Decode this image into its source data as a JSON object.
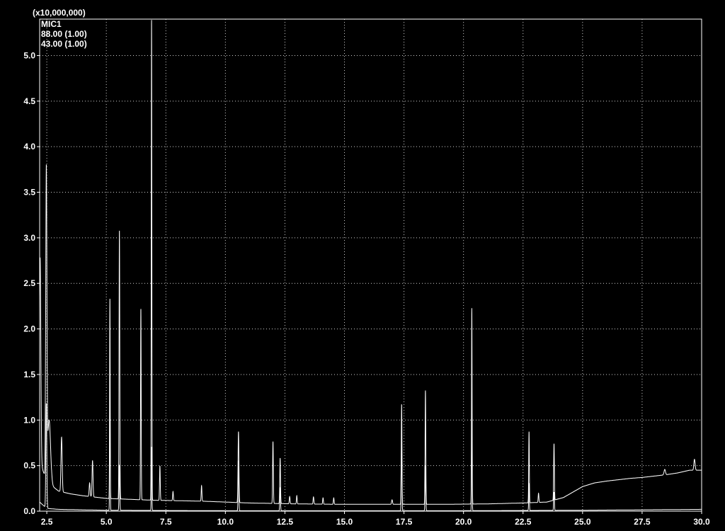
{
  "chart_data": {
    "type": "line",
    "scale_label": "(x10,000,000)",
    "legend": [
      "MIC1",
      "88.00 (1.00)",
      "43.00 (1.00)"
    ],
    "xlabel": "",
    "ylabel": "",
    "xlim": [
      2.2,
      30.0
    ],
    "ylim": [
      0,
      5.4
    ],
    "x_ticks": [
      "2.5",
      "5.0",
      "7.5",
      "10.0",
      "12.5",
      "15.0",
      "17.5",
      "20.0",
      "22.5",
      "25.0",
      "27.5",
      "30.0"
    ],
    "y_ticks": [
      "0.0",
      "0.5",
      "1.0",
      "1.5",
      "2.0",
      "2.5",
      "3.0",
      "3.5",
      "4.0",
      "4.5",
      "5.0"
    ],
    "grid": true,
    "colors": {
      "background": "#000000",
      "trace": "#ffffff",
      "grid": "#ffffff"
    },
    "series": [
      {
        "baseline": [
          [
            2.2,
            0.55
          ],
          [
            2.4,
            0.4
          ],
          [
            2.6,
            0.3
          ],
          [
            3.0,
            0.22
          ],
          [
            3.5,
            0.19
          ],
          [
            4.0,
            0.17
          ],
          [
            5.0,
            0.14
          ],
          [
            6.0,
            0.13
          ],
          [
            7.0,
            0.12
          ],
          [
            8.0,
            0.115
          ],
          [
            9.0,
            0.11
          ],
          [
            10.0,
            0.1
          ],
          [
            11.0,
            0.09
          ],
          [
            12.0,
            0.085
          ],
          [
            13.0,
            0.08
          ],
          [
            15.0,
            0.075
          ],
          [
            17.0,
            0.075
          ],
          [
            19.0,
            0.075
          ],
          [
            21.0,
            0.08
          ],
          [
            22.5,
            0.09
          ],
          [
            23.5,
            0.1
          ],
          [
            24.2,
            0.15
          ],
          [
            25.0,
            0.27
          ],
          [
            25.5,
            0.31
          ],
          [
            26.0,
            0.33
          ],
          [
            27.0,
            0.36
          ],
          [
            27.5,
            0.37
          ],
          [
            28.5,
            0.4
          ],
          [
            29.0,
            0.42
          ],
          [
            29.5,
            0.45
          ],
          [
            30.0,
            0.45
          ]
        ],
        "peaks": [
          {
            "rt": 2.22,
            "h": 2.25,
            "w": 0.03
          },
          {
            "rt": 2.48,
            "h": 3.35,
            "w": 0.025
          },
          {
            "rt": 2.6,
            "h": 0.7,
            "w": 0.06
          },
          {
            "rt": 3.12,
            "h": 0.6,
            "w": 0.025
          },
          {
            "rt": 4.3,
            "h": 0.15,
            "w": 0.02
          },
          {
            "rt": 4.42,
            "h": 0.4,
            "w": 0.02
          },
          {
            "rt": 5.15,
            "h": 2.2,
            "w": 0.012
          },
          {
            "rt": 5.55,
            "h": 2.95,
            "w": 0.015
          },
          {
            "rt": 6.45,
            "h": 2.1,
            "w": 0.013
          },
          {
            "rt": 6.9,
            "h": 5.3,
            "w": 0.012
          },
          {
            "rt": 7.25,
            "h": 0.38,
            "w": 0.015
          },
          {
            "rt": 7.8,
            "h": 0.1,
            "w": 0.015
          },
          {
            "rt": 9.0,
            "h": 0.17,
            "w": 0.015
          },
          {
            "rt": 10.55,
            "h": 0.78,
            "w": 0.018
          },
          {
            "rt": 12.0,
            "h": 0.68,
            "w": 0.015
          },
          {
            "rt": 12.3,
            "h": 0.5,
            "w": 0.015
          },
          {
            "rt": 12.7,
            "h": 0.08,
            "w": 0.015
          },
          {
            "rt": 13.0,
            "h": 0.09,
            "w": 0.015
          },
          {
            "rt": 13.7,
            "h": 0.08,
            "w": 0.015
          },
          {
            "rt": 14.1,
            "h": 0.07,
            "w": 0.015
          },
          {
            "rt": 14.55,
            "h": 0.07,
            "w": 0.015
          },
          {
            "rt": 17.0,
            "h": 0.05,
            "w": 0.02
          },
          {
            "rt": 17.4,
            "h": 1.1,
            "w": 0.014
          },
          {
            "rt": 18.4,
            "h": 1.25,
            "w": 0.014
          },
          {
            "rt": 20.35,
            "h": 2.15,
            "w": 0.012
          },
          {
            "rt": 22.75,
            "h": 0.78,
            "w": 0.013
          },
          {
            "rt": 23.15,
            "h": 0.1,
            "w": 0.015
          },
          {
            "rt": 23.8,
            "h": 0.62,
            "w": 0.015
          },
          {
            "rt": 28.45,
            "h": 0.06,
            "w": 0.03
          },
          {
            "rt": 29.7,
            "h": 0.12,
            "w": 0.025
          }
        ]
      },
      {
        "baseline": [
          [
            2.2,
            0.1
          ],
          [
            2.5,
            0.03
          ],
          [
            3.0,
            0.02
          ],
          [
            5.0,
            0.01
          ],
          [
            10.0,
            0.005
          ],
          [
            20.0,
            0.005
          ],
          [
            25.0,
            0.01
          ],
          [
            30.0,
            0.02
          ]
        ],
        "peaks": [
          {
            "rt": 2.48,
            "h": 1.15,
            "w": 0.02
          },
          {
            "rt": 5.15,
            "h": 1.3,
            "w": 0.012
          },
          {
            "rt": 5.55,
            "h": 0.5,
            "w": 0.015
          },
          {
            "rt": 6.9,
            "h": 0.7,
            "w": 0.012
          },
          {
            "rt": 10.55,
            "h": 0.55,
            "w": 0.015
          },
          {
            "rt": 12.3,
            "h": 0.25,
            "w": 0.015
          },
          {
            "rt": 17.4,
            "h": 0.8,
            "w": 0.014
          },
          {
            "rt": 18.4,
            "h": 0.5,
            "w": 0.014
          },
          {
            "rt": 20.35,
            "h": 1.1,
            "w": 0.012
          },
          {
            "rt": 22.75,
            "h": 0.3,
            "w": 0.013
          },
          {
            "rt": 23.8,
            "h": 0.2,
            "w": 0.015
          }
        ]
      }
    ]
  }
}
